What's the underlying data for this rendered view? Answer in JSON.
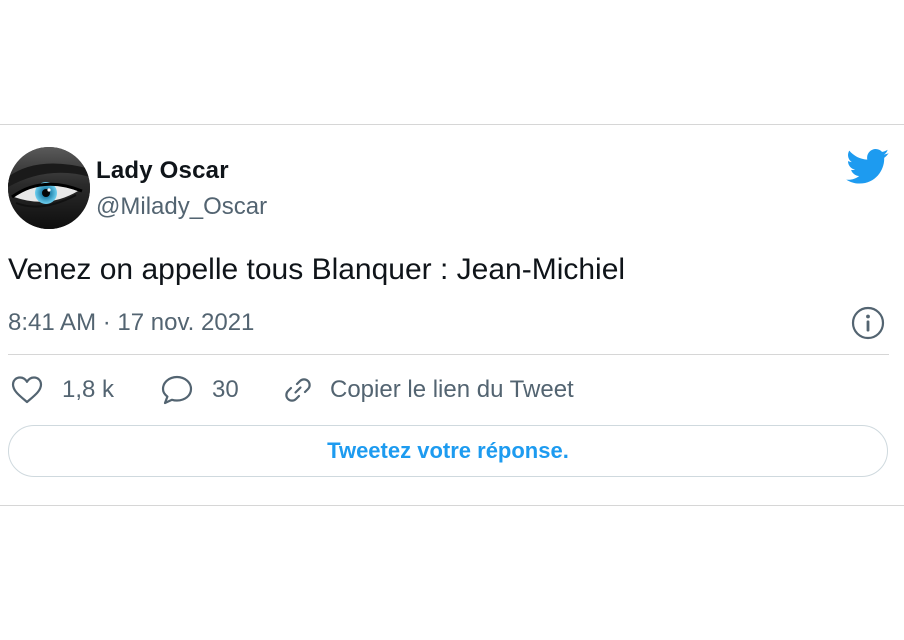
{
  "tweet": {
    "author_name": "Lady Oscar",
    "author_handle": "@Milady_Oscar",
    "text": "Venez on appelle tous Blanquer : Jean-Michiel",
    "timestamp": "8:41 AM · 17 nov. 2021"
  },
  "actions": {
    "likes": "1,8 k",
    "replies": "30",
    "copy_link": "Copier le lien du Tweet"
  },
  "reply_button": {
    "label": "Tweetez votre réponse."
  },
  "icons": {
    "brand": "twitter-bird-icon",
    "info": "info-icon",
    "like": "heart-icon",
    "reply": "speech-bubble-icon",
    "link": "link-icon"
  },
  "colors": {
    "accent": "#1d9bf0",
    "secondary_text": "#536471",
    "border": "#d6d6d6"
  }
}
